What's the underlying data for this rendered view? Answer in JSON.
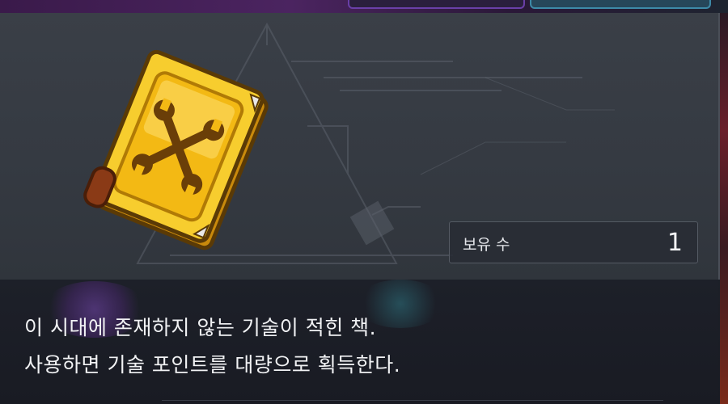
{
  "item": {
    "name": "",
    "icon": "golden-tech-book-icon",
    "owned_label": "보유 수",
    "owned_count": "1"
  },
  "description": {
    "line1": "이 시대에 존재하지 않는 기술이 적힌 책.",
    "line2": "사용하면 기술 포인트를 대량으로 획득한다."
  },
  "colors": {
    "book_gold": "#f2b80e",
    "panel_bg": "#373c44",
    "desc_bg": "#1b1e26",
    "text": "#f1f2f4"
  }
}
